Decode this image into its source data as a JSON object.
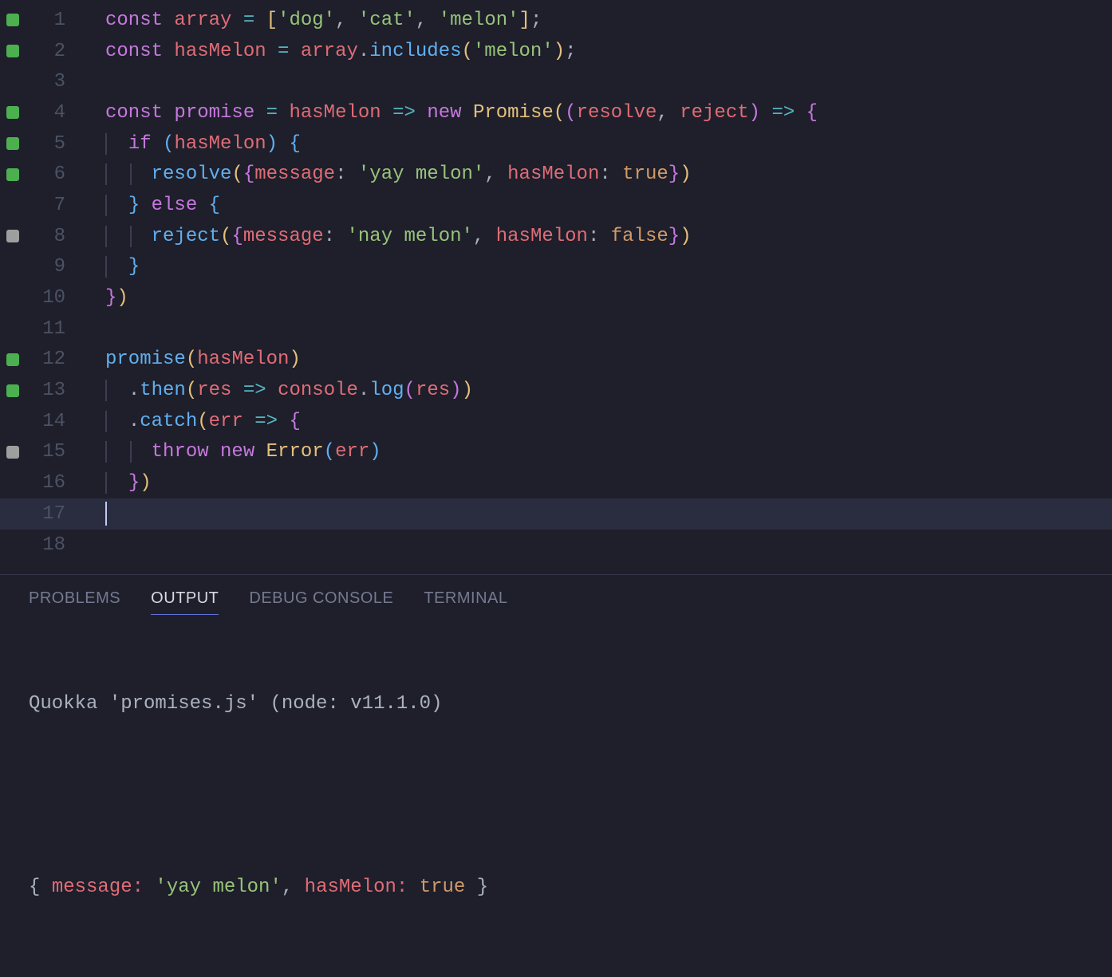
{
  "editor": {
    "lines": [
      {
        "num": "1",
        "marker": "green",
        "tokens": [
          [
            "kw",
            "const"
          ],
          [
            "punc",
            " "
          ],
          [
            "var",
            "array"
          ],
          [
            "punc",
            " "
          ],
          [
            "op",
            "="
          ],
          [
            "punc",
            " "
          ],
          [
            "br-y",
            "["
          ],
          [
            "str",
            "'dog'"
          ],
          [
            "punc",
            ", "
          ],
          [
            "str",
            "'cat'"
          ],
          [
            "punc",
            ", "
          ],
          [
            "str",
            "'melon'"
          ],
          [
            "br-y",
            "]"
          ],
          [
            "punc",
            ";"
          ]
        ]
      },
      {
        "num": "2",
        "marker": "green",
        "tokens": [
          [
            "kw",
            "const"
          ],
          [
            "punc",
            " "
          ],
          [
            "var",
            "hasMelon"
          ],
          [
            "punc",
            " "
          ],
          [
            "op",
            "="
          ],
          [
            "punc",
            " "
          ],
          [
            "var",
            "array"
          ],
          [
            "punc",
            "."
          ],
          [
            "fn",
            "includes"
          ],
          [
            "br-y",
            "("
          ],
          [
            "str",
            "'melon'"
          ],
          [
            "br-y",
            ")"
          ],
          [
            "punc",
            ";"
          ]
        ]
      },
      {
        "num": "3",
        "marker": "",
        "tokens": []
      },
      {
        "num": "4",
        "marker": "green",
        "tokens": [
          [
            "kw",
            "const"
          ],
          [
            "punc",
            " "
          ],
          [
            "fnd",
            "promise"
          ],
          [
            "punc",
            " "
          ],
          [
            "op",
            "="
          ],
          [
            "punc",
            " "
          ],
          [
            "var",
            "hasMelon"
          ],
          [
            "punc",
            " "
          ],
          [
            "op",
            "=>"
          ],
          [
            "punc",
            " "
          ],
          [
            "kw",
            "new"
          ],
          [
            "punc",
            " "
          ],
          [
            "cls",
            "Promise"
          ],
          [
            "br-y",
            "("
          ],
          [
            "br-p",
            "("
          ],
          [
            "var",
            "resolve"
          ],
          [
            "punc",
            ", "
          ],
          [
            "var",
            "reject"
          ],
          [
            "br-p",
            ")"
          ],
          [
            "punc",
            " "
          ],
          [
            "op",
            "=>"
          ],
          [
            "punc",
            " "
          ],
          [
            "br-p",
            "{"
          ]
        ]
      },
      {
        "num": "5",
        "marker": "green",
        "indent": 1,
        "guides": [
          1
        ],
        "tokens": [
          [
            "kw",
            "if"
          ],
          [
            "punc",
            " "
          ],
          [
            "br-b",
            "("
          ],
          [
            "var",
            "hasMelon"
          ],
          [
            "br-b",
            ")"
          ],
          [
            "punc",
            " "
          ],
          [
            "br-b",
            "{"
          ]
        ]
      },
      {
        "num": "6",
        "marker": "green",
        "indent": 2,
        "guides": [
          1,
          2
        ],
        "tokens": [
          [
            "fn",
            "resolve"
          ],
          [
            "br-y",
            "("
          ],
          [
            "br-p",
            "{"
          ],
          [
            "prop",
            "message"
          ],
          [
            "punc",
            ": "
          ],
          [
            "str",
            "'yay melon'"
          ],
          [
            "punc",
            ", "
          ],
          [
            "prop",
            "hasMelon"
          ],
          [
            "punc",
            ": "
          ],
          [
            "bool",
            "true"
          ],
          [
            "br-p",
            "}"
          ],
          [
            "br-y",
            ")"
          ]
        ]
      },
      {
        "num": "7",
        "marker": "",
        "indent": 1,
        "guides": [
          1
        ],
        "tokens": [
          [
            "br-b",
            "}"
          ],
          [
            "punc",
            " "
          ],
          [
            "kw",
            "else"
          ],
          [
            "punc",
            " "
          ],
          [
            "br-b",
            "{"
          ]
        ]
      },
      {
        "num": "8",
        "marker": "grey",
        "indent": 2,
        "guides": [
          1,
          2
        ],
        "tokens": [
          [
            "fn",
            "reject"
          ],
          [
            "br-y",
            "("
          ],
          [
            "br-p",
            "{"
          ],
          [
            "prop",
            "message"
          ],
          [
            "punc",
            ": "
          ],
          [
            "str",
            "'nay melon'"
          ],
          [
            "punc",
            ", "
          ],
          [
            "prop",
            "hasMelon"
          ],
          [
            "punc",
            ": "
          ],
          [
            "bool",
            "false"
          ],
          [
            "br-p",
            "}"
          ],
          [
            "br-y",
            ")"
          ]
        ]
      },
      {
        "num": "9",
        "marker": "",
        "indent": 1,
        "guides": [
          1
        ],
        "tokens": [
          [
            "br-b",
            "}"
          ]
        ]
      },
      {
        "num": "10",
        "marker": "",
        "tokens": [
          [
            "br-p",
            "}"
          ],
          [
            "br-y",
            ")"
          ]
        ]
      },
      {
        "num": "11",
        "marker": "",
        "tokens": []
      },
      {
        "num": "12",
        "marker": "green",
        "tokens": [
          [
            "fn",
            "promise"
          ],
          [
            "br-y",
            "("
          ],
          [
            "var",
            "hasMelon"
          ],
          [
            "br-y",
            ")"
          ]
        ]
      },
      {
        "num": "13",
        "marker": "green",
        "indent": 1,
        "guides": [
          1
        ],
        "tokens": [
          [
            "punc",
            "."
          ],
          [
            "fn",
            "then"
          ],
          [
            "br-y",
            "("
          ],
          [
            "var",
            "res"
          ],
          [
            "punc",
            " "
          ],
          [
            "op",
            "=>"
          ],
          [
            "punc",
            " "
          ],
          [
            "var",
            "console"
          ],
          [
            "punc",
            "."
          ],
          [
            "fn",
            "log"
          ],
          [
            "br-p",
            "("
          ],
          [
            "var",
            "res"
          ],
          [
            "br-p",
            ")"
          ],
          [
            "br-y",
            ")"
          ]
        ]
      },
      {
        "num": "14",
        "marker": "",
        "indent": 1,
        "guides": [
          1
        ],
        "tokens": [
          [
            "punc",
            "."
          ],
          [
            "fn",
            "catch"
          ],
          [
            "br-y",
            "("
          ],
          [
            "var",
            "err"
          ],
          [
            "punc",
            " "
          ],
          [
            "op",
            "=>"
          ],
          [
            "punc",
            " "
          ],
          [
            "br-p",
            "{"
          ]
        ]
      },
      {
        "num": "15",
        "marker": "grey",
        "indent": 2,
        "guides": [
          1,
          2
        ],
        "tokens": [
          [
            "kw",
            "throw"
          ],
          [
            "punc",
            " "
          ],
          [
            "kw",
            "new"
          ],
          [
            "punc",
            " "
          ],
          [
            "cls",
            "Error"
          ],
          [
            "br-b",
            "("
          ],
          [
            "var",
            "err"
          ],
          [
            "br-b",
            ")"
          ]
        ]
      },
      {
        "num": "16",
        "marker": "",
        "indent": 1,
        "guides": [
          1
        ],
        "tokens": [
          [
            "br-p",
            "}"
          ],
          [
            "br-y",
            ")"
          ]
        ]
      },
      {
        "num": "17",
        "marker": "",
        "current": true,
        "cursor": true,
        "tokens": []
      },
      {
        "num": "18",
        "marker": "",
        "tokens": []
      }
    ]
  },
  "panel": {
    "tabs": {
      "problems": "PROBLEMS",
      "output": "OUTPUT",
      "debug": "DEBUG CONSOLE",
      "terminal": "TERMINAL"
    },
    "output_line1": "Quokka 'promises.js' (node: v11.1.0)",
    "output_obj": {
      "open": "{ ",
      "k1": "message:",
      "v1": " 'yay melon'",
      "sep": ", ",
      "k2": "hasMelon:",
      "v2": " true",
      "close": " }"
    }
  }
}
